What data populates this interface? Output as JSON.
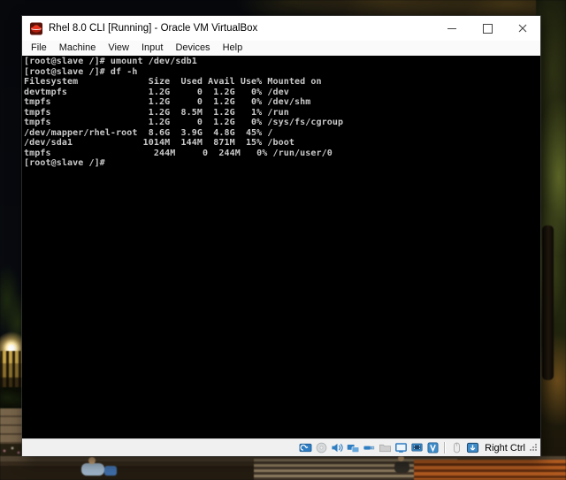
{
  "window": {
    "title": "Rhel 8.0 CLI [Running] - Oracle VM VirtualBox"
  },
  "menu": {
    "items": [
      "File",
      "Machine",
      "View",
      "Input",
      "Devices",
      "Help"
    ]
  },
  "terminal": {
    "lines": [
      "[root@slave /]# umount /dev/sdb1",
      "[root@slave /]# df -h",
      "Filesystem             Size  Used Avail Use% Mounted on",
      "devtmpfs               1.2G     0  1.2G   0% /dev",
      "tmpfs                  1.2G     0  1.2G   0% /dev/shm",
      "tmpfs                  1.2G  8.5M  1.2G   1% /run",
      "tmpfs                  1.2G     0  1.2G   0% /sys/fs/cgroup",
      "/dev/mapper/rhel-root  8.6G  3.9G  4.8G  45% /",
      "/dev/sda1             1014M  144M  871M  15% /boot",
      "tmpfs                   244M     0  244M   0% /run/user/0",
      "[root@slave /]#"
    ]
  },
  "statusbar": {
    "host_key_label": "Right Ctrl",
    "icons": [
      "hard-disks-icon",
      "optical-drives-icon",
      "audio-icon",
      "network-icon",
      "usb-icon",
      "shared-folders-icon",
      "display-icon",
      "recording-icon",
      "features-icon",
      "mouse-integration-icon",
      "keyboard-capture-icon"
    ]
  },
  "colors": {
    "titlebar_bg": "#ffffff",
    "menubar_bg": "#fafafa",
    "statusbar_bg": "#f0f0f0",
    "terminal_bg": "#000000",
    "terminal_fg": "#c9c9c9",
    "icon_blue": "#2f7dc2",
    "bench_orange": "#b05a20"
  }
}
